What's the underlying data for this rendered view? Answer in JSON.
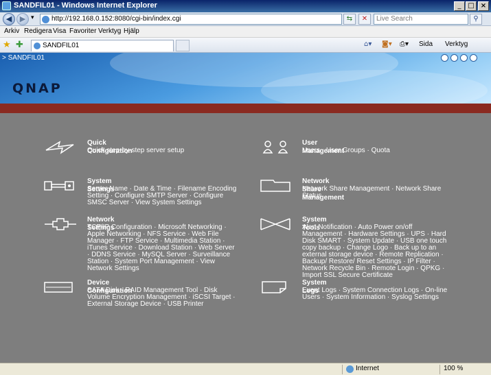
{
  "window": {
    "title": "SANDFIL01 - Windows Internet Explorer"
  },
  "address": {
    "url": "http://192.168.0.152:8080/cgi-bin/index.cgi"
  },
  "search": {
    "placeholder": "Live Search"
  },
  "menu": [
    "Arkiv",
    "Redigera",
    "Visa",
    "Favoriter",
    "Verktyg",
    "Hjälp"
  ],
  "tab": {
    "label": "SANDFIL01"
  },
  "commandbar": {
    "page": "Sida",
    "tools": "Verktyg"
  },
  "page": {
    "breadcrumb": "> SANDFIL01",
    "logo": "QNAP",
    "items": [
      {
        "title": "Quick Configuration",
        "desc": "Quick step-by-step server setup"
      },
      {
        "title": "User Management",
        "desc": "Users · User Groups · Quota"
      },
      {
        "title": "System Settings",
        "desc": "Server Name · Date & Time · Filename Encoding Setting · Configure SMTP Server · Configure SMSC Server · View System Settings"
      },
      {
        "title": "Network Share Management",
        "desc": "Network Share Management · Network Share Status"
      },
      {
        "title": "Network Settings",
        "desc": "TCP/IP Configuration · Microsoft Networking · Apple Networking · NFS Service · Web File Manager · FTP Service · Multimedia Station · iTunes Service · Download Station · Web Server · DDNS Service · MySQL Server · Surveillance Station · System Port Management · View Network Settings"
      },
      {
        "title": "System Tools",
        "desc": "Alert Notification · Auto Power on/off Management · Hardware Settings · UPS · Hard Disk SMART · System Update · USB one touch copy backup · Change Logo · Back up to an external storage device · Remote Replication · Backup/ Restore/ Reset Settings · IP Filter · Network Recycle Bin · Remote Login · QPKG · Import SSL Secure Certificate"
      },
      {
        "title": "Device Configuration",
        "desc": "SATA Disk · RAID Management Tool · Disk Volume Encryption Management · iSCSI Target · External Storage Device · USB Printer"
      },
      {
        "title": "System Logs",
        "desc": "Event Logs · System Connection Logs · On-line Users · System Information · Syslog Settings"
      }
    ]
  },
  "status": {
    "zone": "Internet",
    "zoom": "100 %"
  }
}
